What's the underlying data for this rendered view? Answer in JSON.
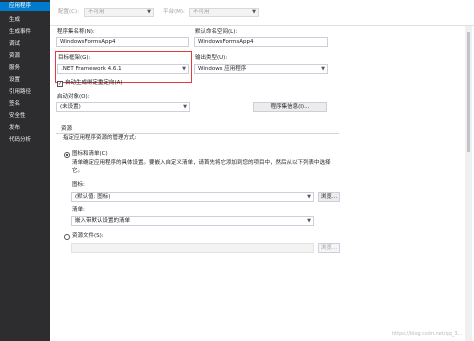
{
  "sidebar": {
    "items": [
      {
        "label": "应用程序"
      },
      {
        "label": "生成"
      },
      {
        "label": "生成事件"
      },
      {
        "label": "调试"
      },
      {
        "label": "资源"
      },
      {
        "label": "服务"
      },
      {
        "label": "设置"
      },
      {
        "label": "引用路径"
      },
      {
        "label": "签名"
      },
      {
        "label": "安全性"
      },
      {
        "label": "发布"
      },
      {
        "label": "代码分析"
      }
    ]
  },
  "topbar": {
    "config_label": "配置(C):",
    "config_value": "不可用",
    "platform_label": "平台(M):",
    "platform_value": "不可用"
  },
  "app": {
    "assembly_name_label": "程序集名称(N):",
    "assembly_name_value": "WindowsFormsApp4",
    "default_namespace_label": "默认命名空间(L):",
    "default_namespace_value": "WindowsFormsApp4",
    "target_framework_label": "目标框架(G):",
    "target_framework_value": ".NET Framework 4.6.1",
    "output_type_label": "输出类型(U):",
    "output_type_value": "Windows 应用程序",
    "auto_redirect_label": "自动生成绑定重定向(A)",
    "startup_object_label": "启动对象(O):",
    "startup_object_value": "(未设置)",
    "assembly_info_button": "程序集信息(I)..."
  },
  "resources": {
    "section_title": "资源",
    "description": "指定应用程序资源的管理方式:",
    "icon_and_manifest_label": "图标和清单(C)",
    "icon_and_manifest_desc_1": "清单确定应用程序的具体设置。要嵌入自定义清单，请首先将它添加到您的项目中，然后从以下列表中选择",
    "icon_and_manifest_desc_2": "它。",
    "icon_label": "图标:",
    "icon_value": "(默认值: 图标)",
    "browse_button": "浏览...",
    "manifest_label": "清单:",
    "manifest_value": "嵌入带默认设置的清单",
    "resource_file_label": "资源文件(S):",
    "resource_browse_button": "浏览..."
  },
  "watermark": "https://blog.csdn.net/qq_3..."
}
